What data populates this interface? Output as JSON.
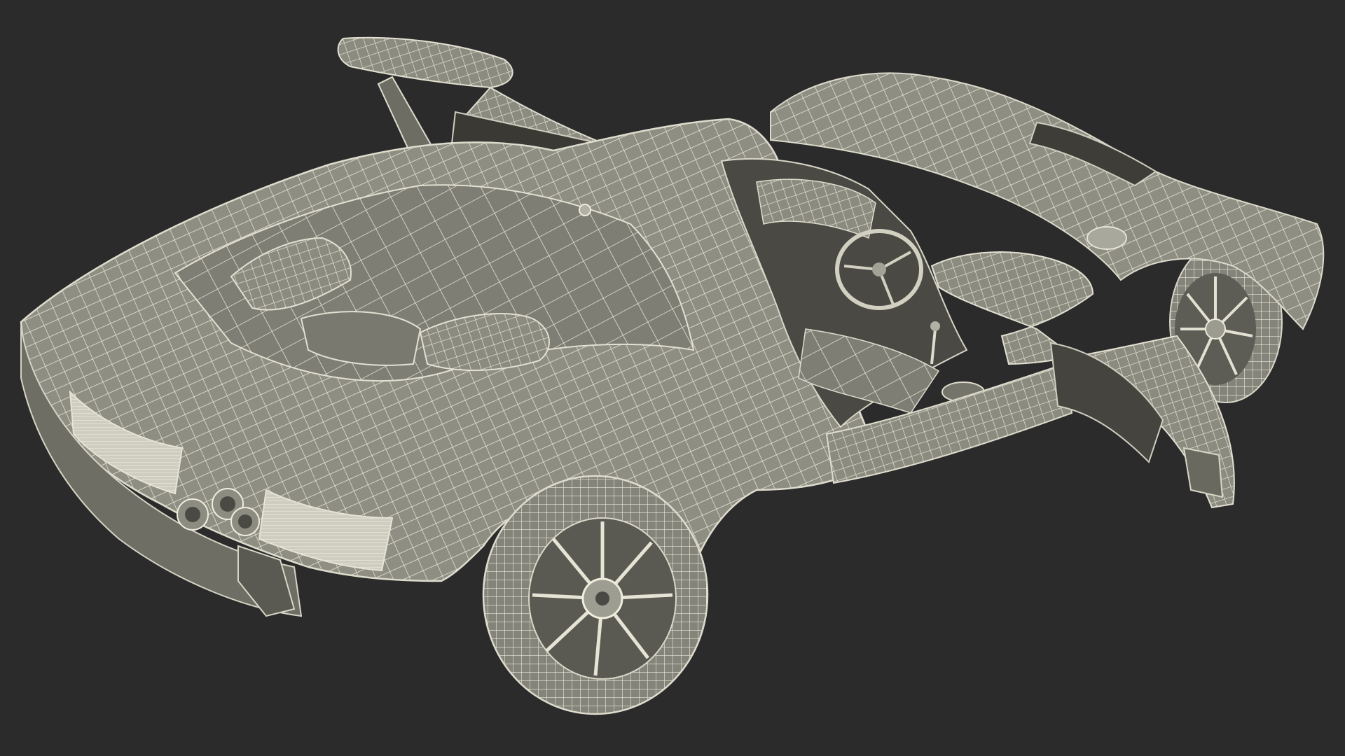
{
  "scene": {
    "background_color": "#2b2b2b",
    "model_fill_color": "#8c8b80",
    "model_shadow_color": "#55544d",
    "wireframe_color": "#e8e6d8",
    "cavity_color": "#3c3b36"
  }
}
